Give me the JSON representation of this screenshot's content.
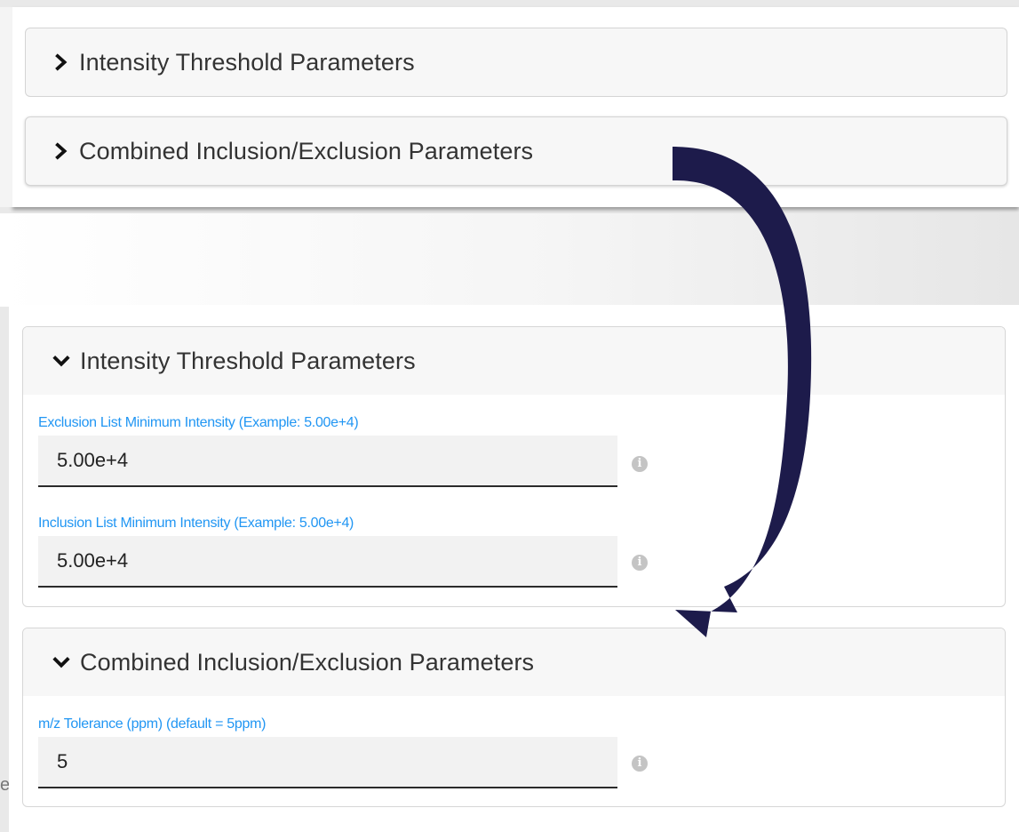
{
  "top": {
    "panels": [
      {
        "title": "Intensity Threshold Parameters",
        "state": "collapsed",
        "chevron": "chevron-right-icon"
      },
      {
        "title": "Combined Inclusion/Exclusion Parameters",
        "state": "collapsed",
        "chevron": "chevron-right-icon"
      }
    ]
  },
  "bottom": {
    "intensity_panel": {
      "title": "Intensity Threshold Parameters",
      "chevron": "chevron-down-icon",
      "fields": [
        {
          "label": "Exclusion List Minimum Intensity (Example: 5.00e+4)",
          "value": "5.00e+4",
          "icon": "info-icon"
        },
        {
          "label": "Inclusion List Minimum Intensity (Example: 5.00e+4)",
          "value": "5.00e+4",
          "icon": "info-icon"
        }
      ]
    },
    "combined_panel": {
      "title": "Combined Inclusion/Exclusion Parameters",
      "chevron": "chevron-down-icon",
      "fields": [
        {
          "label": "m/z Tolerance (ppm) (default = 5ppm)",
          "value": "5",
          "icon": "info-icon"
        }
      ]
    }
  },
  "colors": {
    "label": "#2196f3",
    "arrow": "#1d1b4b",
    "panel_header": "#f7f7f7",
    "input_bg": "#f2f2f2",
    "text": "#333333"
  },
  "info_glyph": "i",
  "edge_fragment": "e"
}
